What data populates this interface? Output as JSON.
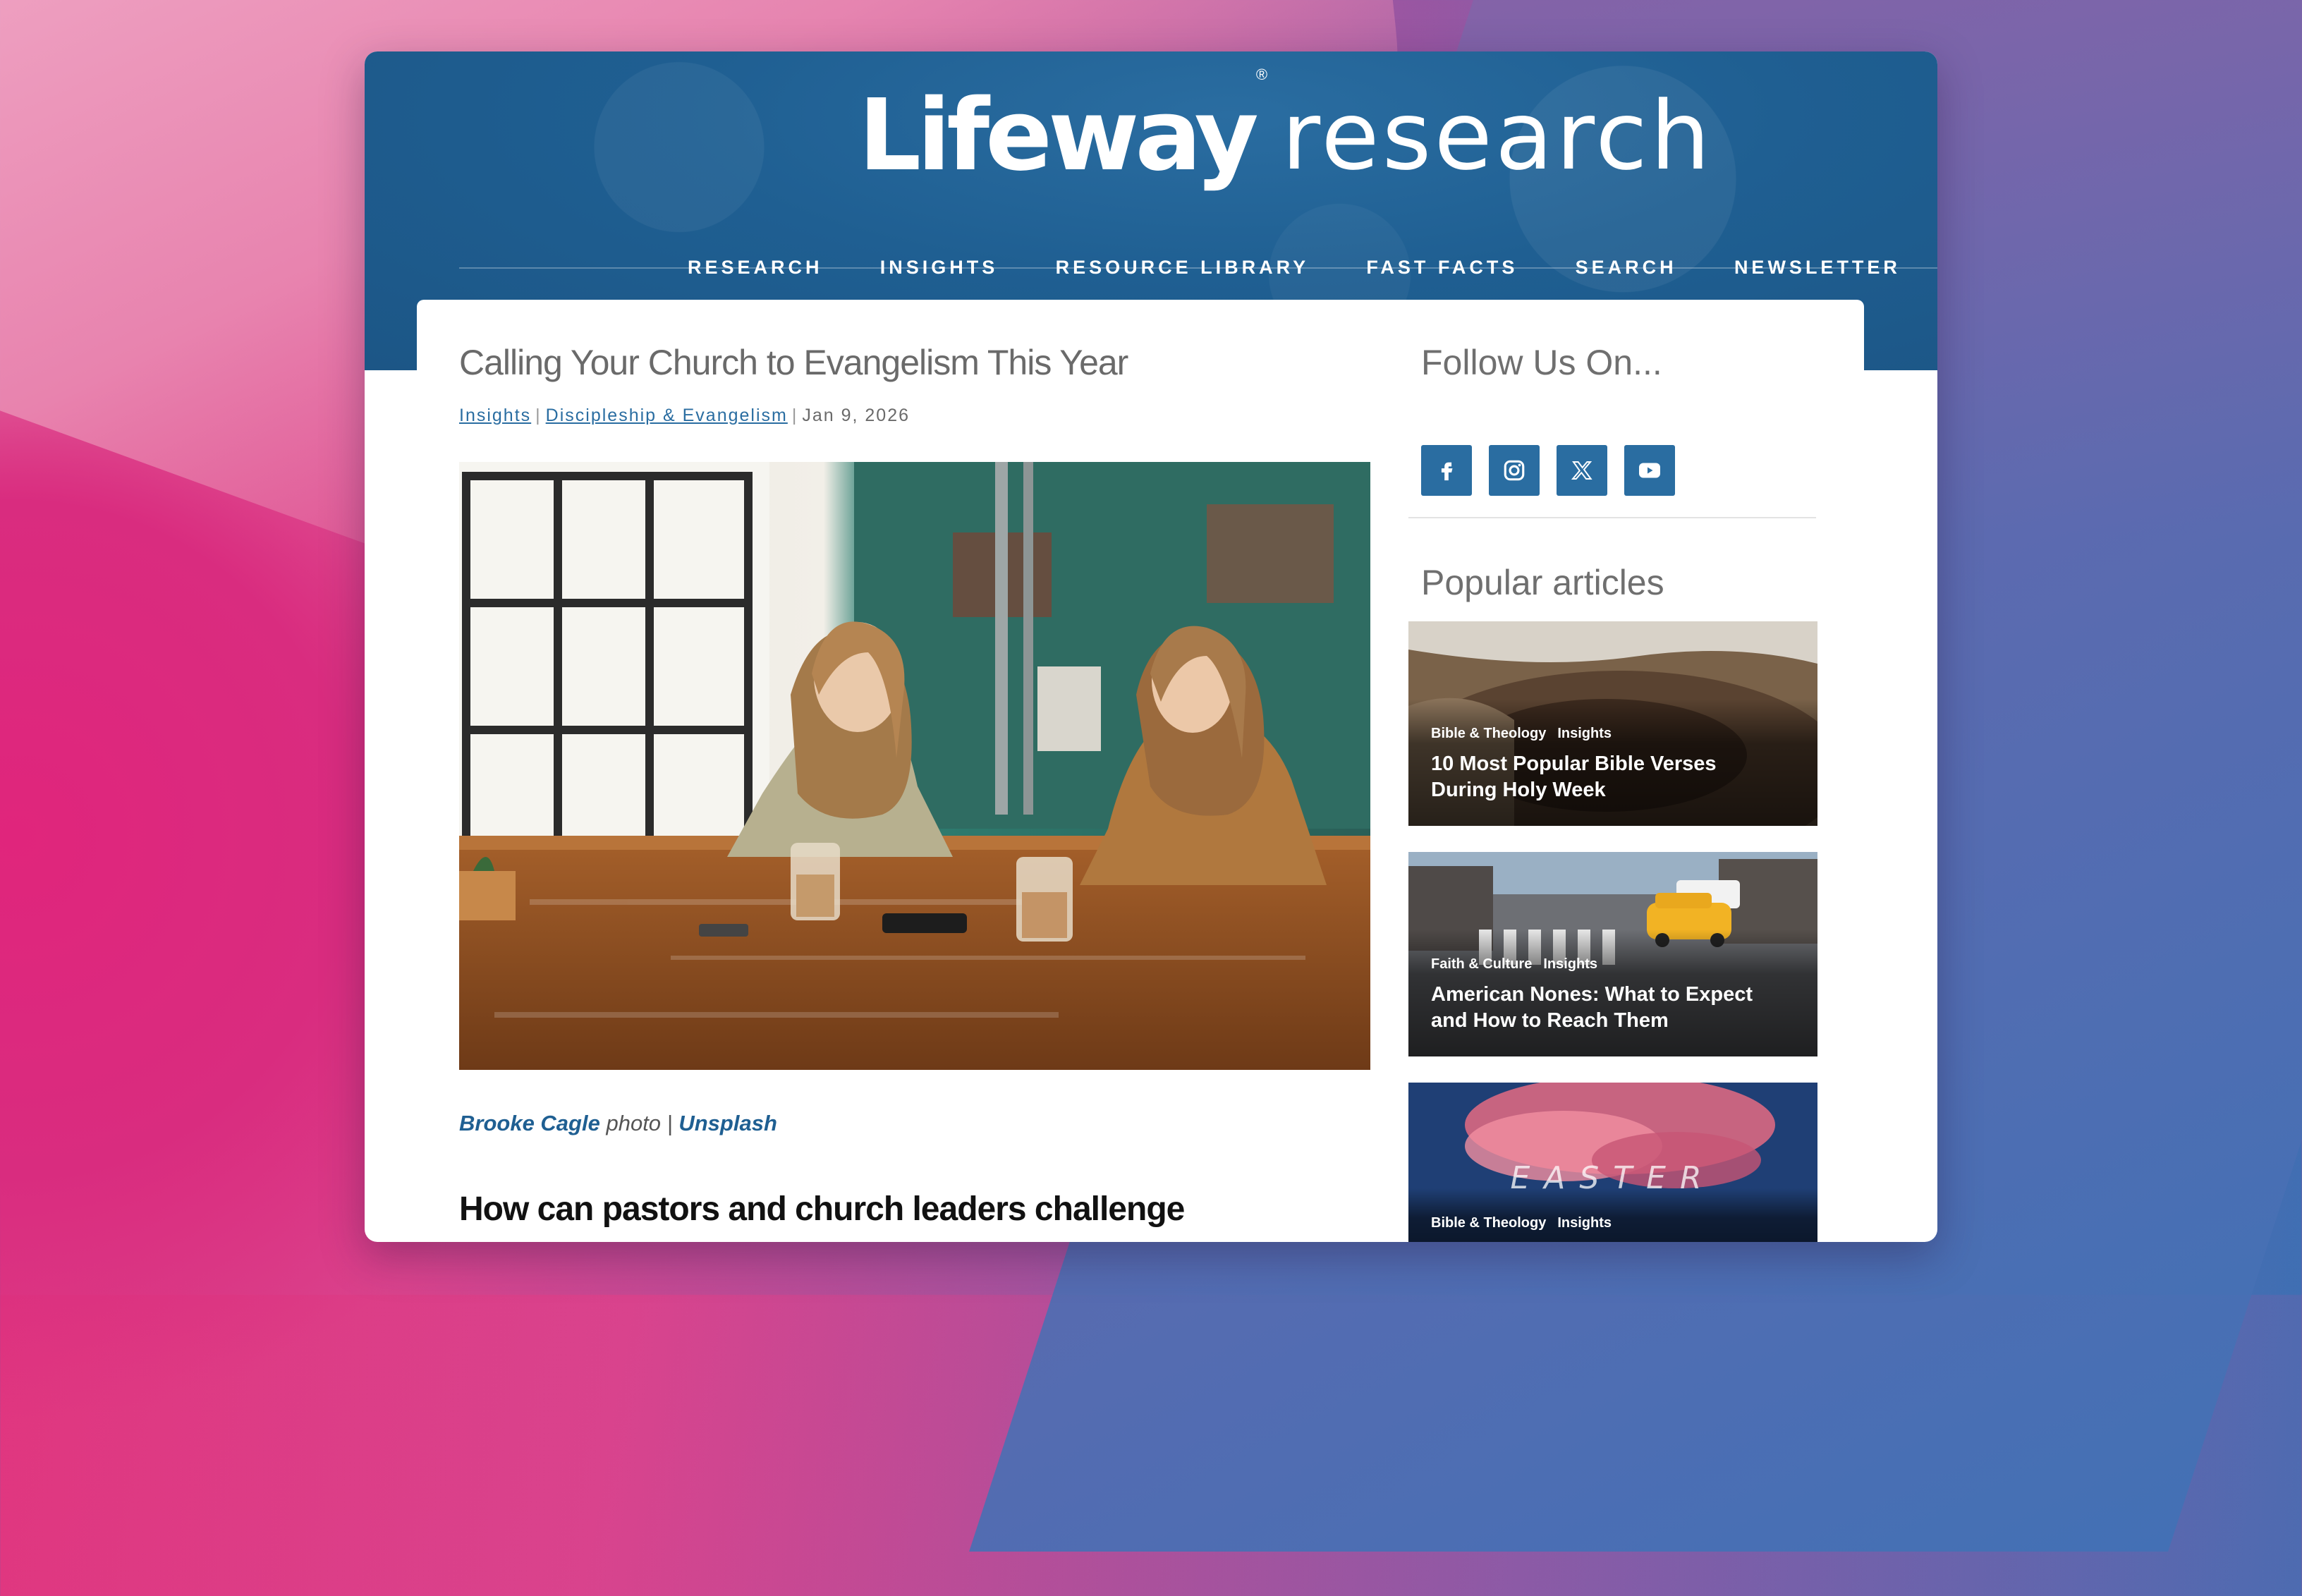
{
  "site": {
    "brand": "Lifeway",
    "product": "research"
  },
  "nav": {
    "items": [
      "RESEARCH",
      "INSIGHTS",
      "RESOURCE LIBRARY",
      "FAST FACTS",
      "SEARCH",
      "NEWSLETTER"
    ]
  },
  "article": {
    "title": "Calling Your Church to Evangelism This Year",
    "categories": [
      "Insights",
      "Discipleship & Evangelism"
    ],
    "date": "Jan 9, 2026",
    "credit": {
      "author": "Brooke Cagle",
      "word": "photo",
      "separator": "|",
      "source": "Unsplash"
    },
    "section_heading": "How can pastors and church leaders challenge"
  },
  "sidebar": {
    "follow_heading": "Follow Us On...",
    "social": [
      {
        "icon": "facebook-icon",
        "label": "f"
      },
      {
        "icon": "instagram-icon",
        "label": "instagram"
      },
      {
        "icon": "x-icon",
        "label": "𝕏"
      },
      {
        "icon": "youtube-icon",
        "label": "youtube"
      }
    ],
    "popular_heading": "Popular articles",
    "articles": [
      {
        "tags": [
          "Bible & Theology",
          "Insights"
        ],
        "title": "10 Most Popular Bible Verses During Holy Week"
      },
      {
        "tags": [
          "Faith & Culture",
          "Insights"
        ],
        "title": "American Nones: What to Expect and How to Reach Them"
      },
      {
        "tags": [
          "Bible & Theology",
          "Insights"
        ],
        "title": "",
        "image_text": "EASTER"
      }
    ]
  },
  "colors": {
    "header_blue": "#1f5f92",
    "link_blue": "#2a6da1",
    "heading_gray": "#6a6a6a"
  }
}
